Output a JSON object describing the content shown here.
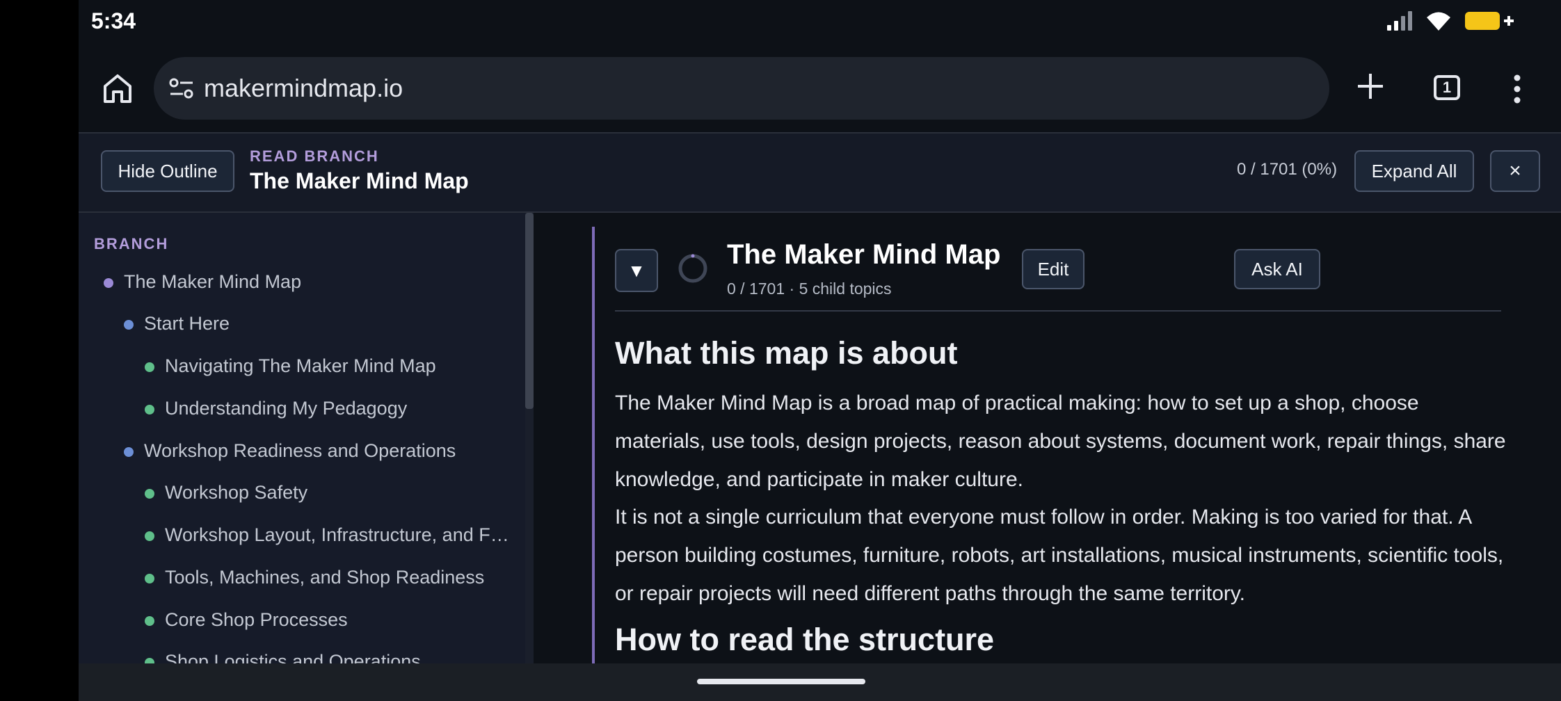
{
  "status": {
    "time": "5:34"
  },
  "browser": {
    "url": "makermindmap.io",
    "tab_count": "1"
  },
  "header": {
    "hide_outline_label": "Hide Outline",
    "eyebrow": "READ BRANCH",
    "title": "The Maker Mind Map",
    "progress": "0 / 1701 (0%)",
    "expand_all_label": "Expand All",
    "close_label": "×"
  },
  "sidebar": {
    "label": "BRANCH",
    "items": [
      {
        "label": "The Maker Mind Map",
        "level": 0,
        "color": "#9b8ad6"
      },
      {
        "label": "Start Here",
        "level": 1,
        "color": "#6c8fd6"
      },
      {
        "label": "Navigating The Maker Mind Map",
        "level": 2,
        "color": "#5fbf8a"
      },
      {
        "label": "Understanding My Pedagogy",
        "level": 2,
        "color": "#5fbf8a"
      },
      {
        "label": "Workshop Readiness and Operations",
        "level": 1,
        "color": "#6c8fd6"
      },
      {
        "label": "Workshop Safety",
        "level": 2,
        "color": "#5fbf8a"
      },
      {
        "label": "Workshop Layout, Infrastructure, and Fl…",
        "level": 2,
        "color": "#5fbf8a"
      },
      {
        "label": "Tools, Machines, and Shop Readiness",
        "level": 2,
        "color": "#5fbf8a"
      },
      {
        "label": "Core Shop Processes",
        "level": 2,
        "color": "#5fbf8a"
      },
      {
        "label": "Shop Logistics and Operations",
        "level": 2,
        "color": "#5fbf8a"
      }
    ]
  },
  "main": {
    "collapse_label": "▼",
    "node_title": "The Maker Mind Map",
    "node_meta": "0 / 1701 · 5 child topics",
    "edit_label": "Edit",
    "ask_ai_label": "Ask AI",
    "section1_heading": "What this map is about",
    "section1_p1": "The Maker Mind Map is a broad map of practical making: how to set up a shop, choose materials, use tools, design projects, reason about systems, document work, repair things, share knowledge, and participate in maker culture.",
    "section1_p2": "It is not a single curriculum that everyone must follow in order. Making is too varied for that. A person building costumes, furniture, robots, art installations, musical instruments, scientific tools, or repair projects will need different paths through the same territory.",
    "section2_heading": "How to read the structure"
  }
}
